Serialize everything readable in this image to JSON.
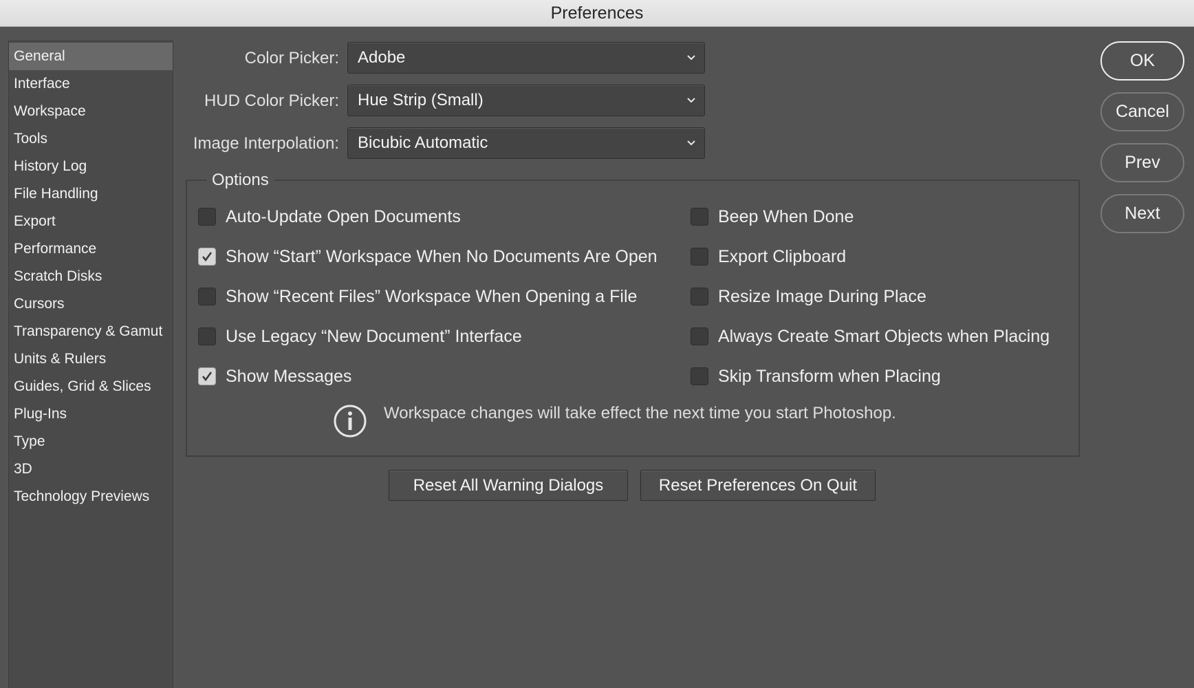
{
  "window": {
    "title": "Preferences"
  },
  "sidebar": {
    "items": [
      {
        "label": "General",
        "selected": true
      },
      {
        "label": "Interface"
      },
      {
        "label": "Workspace"
      },
      {
        "label": "Tools"
      },
      {
        "label": "History Log"
      },
      {
        "label": "File Handling"
      },
      {
        "label": "Export"
      },
      {
        "label": "Performance"
      },
      {
        "label": "Scratch Disks"
      },
      {
        "label": "Cursors"
      },
      {
        "label": "Transparency & Gamut"
      },
      {
        "label": "Units & Rulers"
      },
      {
        "label": "Guides, Grid & Slices"
      },
      {
        "label": "Plug-Ins"
      },
      {
        "label": "Type"
      },
      {
        "label": "3D"
      },
      {
        "label": "Technology Previews"
      }
    ]
  },
  "form": {
    "color_picker": {
      "label": "Color Picker:",
      "value": "Adobe"
    },
    "hud_color_picker": {
      "label": "HUD Color Picker:",
      "value": "Hue Strip (Small)"
    },
    "image_interpolation": {
      "label": "Image Interpolation:",
      "value": "Bicubic Automatic"
    }
  },
  "options": {
    "title": "Options",
    "left": [
      {
        "label": "Auto-Update Open Documents",
        "checked": false
      },
      {
        "label": "Show “Start” Workspace When No Documents Are Open",
        "checked": true
      },
      {
        "label": "Show “Recent Files” Workspace When Opening a File",
        "checked": false
      },
      {
        "label": "Use Legacy “New Document” Interface",
        "checked": false
      },
      {
        "label": "Show Messages",
        "checked": true
      }
    ],
    "right": [
      {
        "label": "Beep When Done",
        "checked": false
      },
      {
        "label": "Export Clipboard",
        "checked": false
      },
      {
        "label": "Resize Image During Place",
        "checked": false
      },
      {
        "label": "Always Create Smart Objects when Placing",
        "checked": false
      },
      {
        "label": "Skip Transform when Placing",
        "checked": false
      }
    ],
    "info_icon": "info-circle-icon",
    "info_text": "Workspace changes will take effect the next time you start Photoshop."
  },
  "buttons": {
    "reset_warnings": "Reset All Warning Dialogs",
    "reset_prefs": "Reset Preferences On Quit",
    "ok": "OK",
    "cancel": "Cancel",
    "prev": "Prev",
    "next": "Next"
  },
  "colors": {
    "dialog_bg": "#535353",
    "sidebar_bg": "#4a4a4a",
    "selected_item": "#696969"
  }
}
